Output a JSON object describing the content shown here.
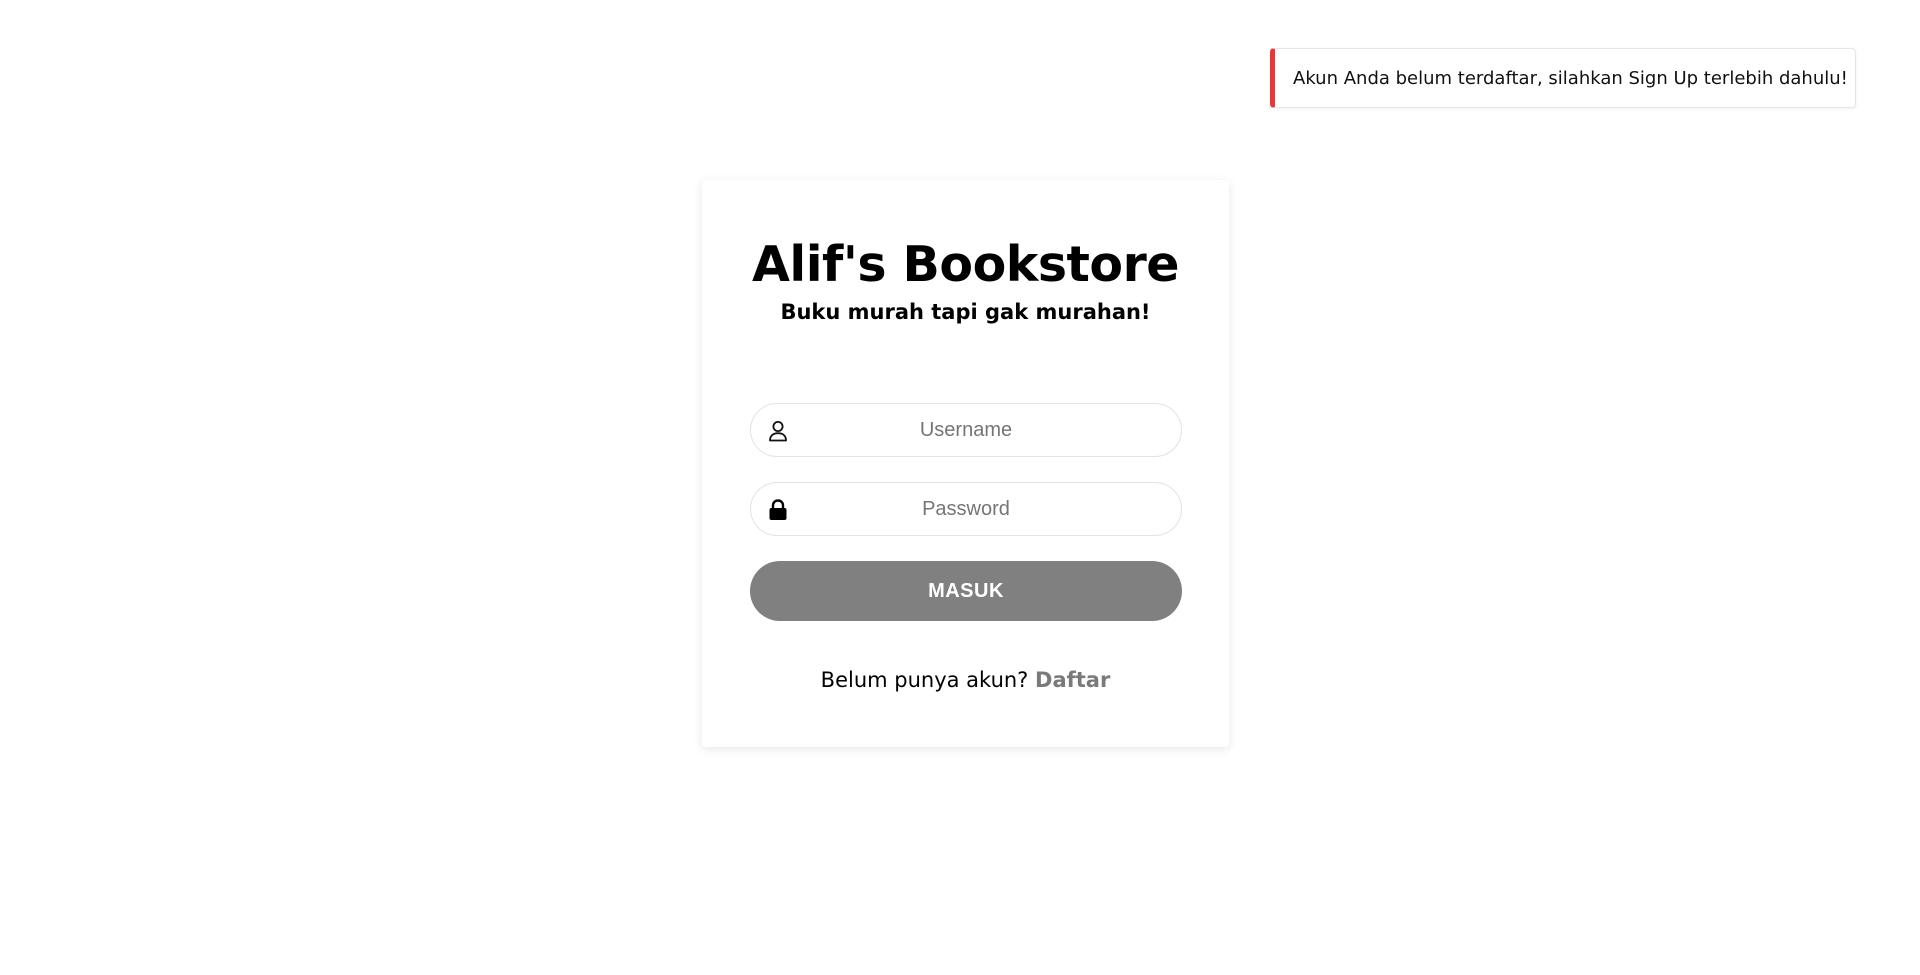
{
  "toast": {
    "message": "Akun Anda belum terdaftar, silahkan Sign Up terlebih dahulu!",
    "accent_color": "#e53935"
  },
  "login": {
    "title": "Alif's Bookstore",
    "subtitle": "Buku murah tapi gak murahan!",
    "username": {
      "placeholder": "Username",
      "value": "",
      "icon": "user-icon"
    },
    "password": {
      "placeholder": "Password",
      "value": "",
      "icon": "lock-icon"
    },
    "submit_label": "MASUK",
    "submit_color": "#808080",
    "signup_prompt": "Belum punya akun?",
    "signup_link": "Daftar"
  }
}
